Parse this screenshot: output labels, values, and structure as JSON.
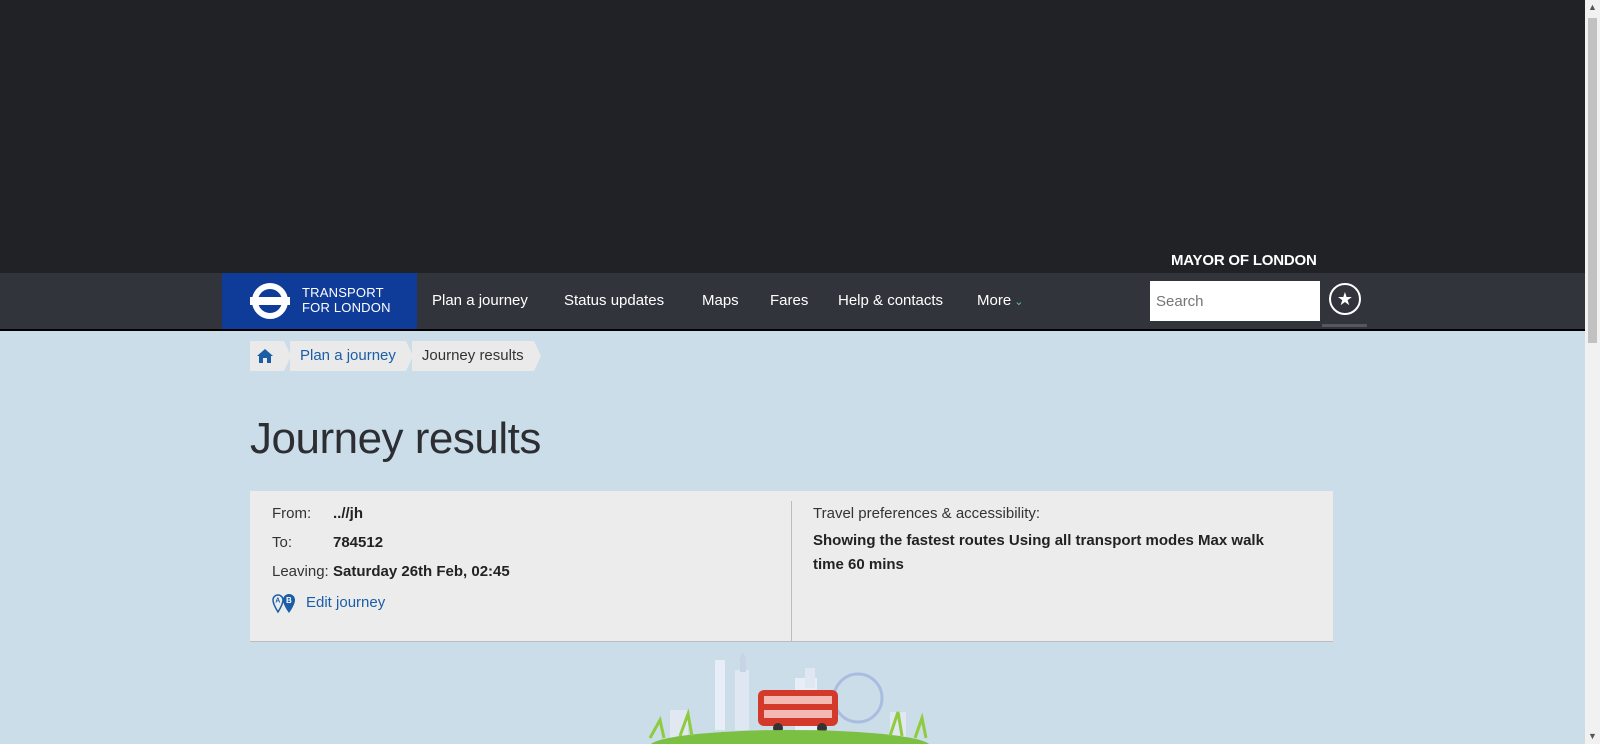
{
  "header": {
    "mayor_text": "MAYOR OF LONDON",
    "logo_line1": "TRANSPORT",
    "logo_line2": "FOR LONDON",
    "nav": [
      {
        "label": "Plan a journey"
      },
      {
        "label": "Status updates"
      },
      {
        "label": "Maps"
      },
      {
        "label": "Fares"
      },
      {
        "label": "Help & contacts"
      },
      {
        "label": "More"
      }
    ],
    "search_placeholder": "Search"
  },
  "breadcrumb": {
    "home_icon": "home-icon",
    "items": [
      "Plan a journey",
      "Journey results"
    ]
  },
  "page_title": "Journey results",
  "summary": {
    "from_label": "From:",
    "from_value": "..//jh",
    "to_label": "To:",
    "to_value": "784512",
    "leaving_label": "Leaving:",
    "leaving_value": "Saturday 26th Feb, 02:45",
    "edit_label": "Edit journey",
    "prefs_label": "Travel preferences & accessibility:",
    "prefs_value": "Showing the fastest routes Using all transport modes Max walk time 60 mins"
  },
  "colors": {
    "header_dark": "#212226",
    "nav_bg": "#31343b",
    "logo_blue": "#0f3b99",
    "page_bg": "#cbdde8",
    "link": "#1b5da6",
    "panel_bg": "#ececec"
  }
}
